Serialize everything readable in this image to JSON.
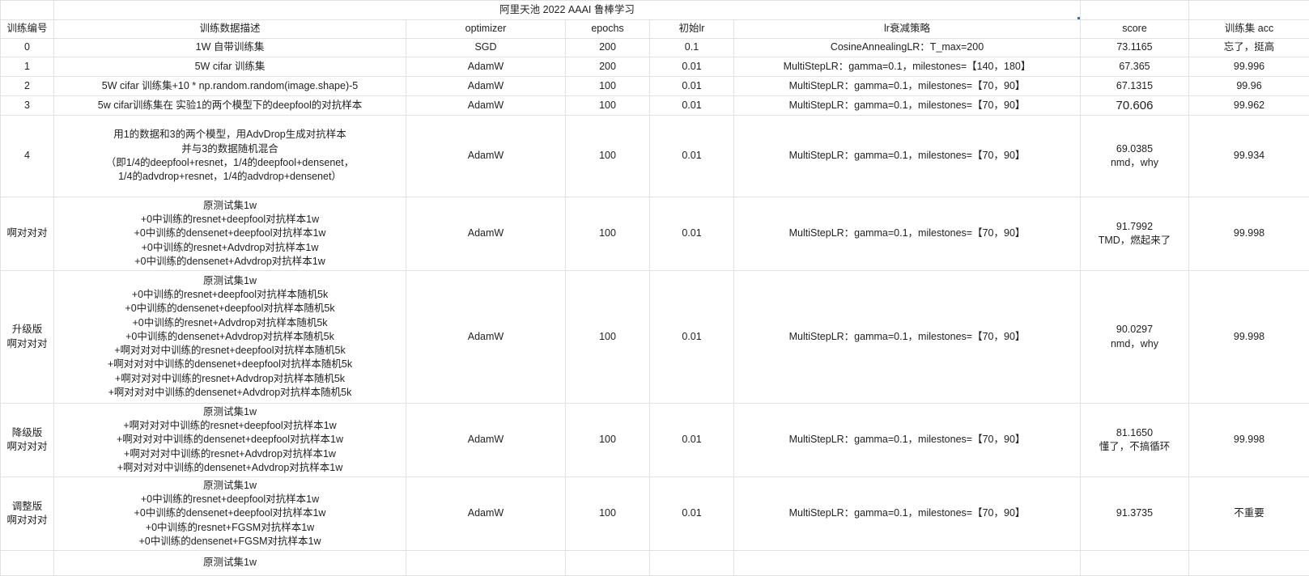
{
  "sheet": {
    "title": "阿里天池 2022 AAAI 鲁棒学习",
    "headers": [
      "训练编号",
      "训练数据描述",
      "optimizer",
      "epochs",
      "初始lr",
      "lr衰减策略",
      "score",
      "训练集 acc"
    ],
    "rows": [
      {
        "id": [
          "0"
        ],
        "desc": [
          "1W 自带训练集"
        ],
        "optimizer": "SGD",
        "epochs": "200",
        "lr": "0.1",
        "lr_strategy": "CosineAnnealingLR：T_max=200",
        "score": [
          "73.1165"
        ],
        "train_acc": "忘了，挺高"
      },
      {
        "id": [
          "1"
        ],
        "desc": [
          "5W cifar 训练集"
        ],
        "optimizer": "AdamW",
        "epochs": "200",
        "lr": "0.01",
        "lr_strategy": "MultiStepLR：gamma=0.1，milestones=【140，180】",
        "score": [
          "67.365"
        ],
        "train_acc": "99.996"
      },
      {
        "id": [
          "2"
        ],
        "desc": [
          "5W cifar 训练集+10 * np.random.random(image.shape)-5"
        ],
        "optimizer": "AdamW",
        "epochs": "100",
        "lr": "0.01",
        "lr_strategy": "MultiStepLR：gamma=0.1，milestones=【70，90】",
        "score": [
          "67.1315"
        ],
        "train_acc": "99.96"
      },
      {
        "id": [
          "3"
        ],
        "desc": [
          "5w cifar训练集在 实验1的两个模型下的deepfool的对抗样本"
        ],
        "optimizer": "AdamW",
        "epochs": "100",
        "lr": "0.01",
        "lr_strategy": "MultiStepLR：gamma=0.1，milestones=【70，90】",
        "score": [
          "70.606"
        ],
        "train_acc": "99.962"
      },
      {
        "id": [
          "4"
        ],
        "desc": [
          "用1的数据和3的两个模型，用AdvDrop生成对抗样本",
          "并与3的数据随机混合",
          "（即1/4的deepfool+resnet，1/4的deepfool+densenet，",
          "1/4的advdrop+resnet，1/4的advdrop+densenet）"
        ],
        "optimizer": "AdamW",
        "epochs": "100",
        "lr": "0.01",
        "lr_strategy": "MultiStepLR：gamma=0.1，milestones=【70，90】",
        "score": [
          "69.0385",
          "nmd，why"
        ],
        "train_acc": "99.934"
      },
      {
        "id": [
          "啊对对对"
        ],
        "desc": [
          "原测试集1w",
          "+0中训练的resnet+deepfool对抗样本1w",
          "+0中训练的densenet+deepfool对抗样本1w",
          "+0中训练的resnet+Advdrop对抗样本1w",
          "+0中训练的densenet+Advdrop对抗样本1w"
        ],
        "optimizer": "AdamW",
        "epochs": "100",
        "lr": "0.01",
        "lr_strategy": "MultiStepLR：gamma=0.1，milestones=【70，90】",
        "score": [
          "91.7992",
          "TMD，燃起来了"
        ],
        "train_acc": "99.998"
      },
      {
        "id": [
          "升级版",
          "啊对对对"
        ],
        "desc": [
          "原测试集1w",
          "+0中训练的resnet+deepfool对抗样本随机5k",
          "+0中训练的densenet+deepfool对抗样本随机5k",
          "+0中训练的resnet+Advdrop对抗样本随机5k",
          "+0中训练的densenet+Advdrop对抗样本随机5k",
          "+啊对对对中训练的resnet+deepfool对抗样本随机5k",
          "+啊对对对中训练的densenet+deepfool对抗样本随机5k",
          "+啊对对对中训练的resnet+Advdrop对抗样本随机5k",
          "+啊对对对中训练的densenet+Advdrop对抗样本随机5k"
        ],
        "optimizer": "AdamW",
        "epochs": "100",
        "lr": "0.01",
        "lr_strategy": "MultiStepLR：gamma=0.1，milestones=【70，90】",
        "score": [
          "90.0297",
          "nmd，why"
        ],
        "train_acc": "99.998"
      },
      {
        "id": [
          "降级版",
          "啊对对对"
        ],
        "desc": [
          "原测试集1w",
          "+啊对对对中训练的resnet+deepfool对抗样本1w",
          "+啊对对对中训练的densenet+deepfool对抗样本1w",
          "+啊对对对中训练的resnet+Advdrop对抗样本1w",
          "+啊对对对中训练的densenet+Advdrop对抗样本1w"
        ],
        "optimizer": "AdamW",
        "epochs": "100",
        "lr": "0.01",
        "lr_strategy": "MultiStepLR：gamma=0.1，milestones=【70，90】",
        "score": [
          "81.1650",
          "懂了，不搞循环"
        ],
        "train_acc": "99.998"
      },
      {
        "id": [
          "调整版",
          "啊对对对"
        ],
        "desc": [
          "原测试集1w",
          "+0中训练的resnet+deepfool对抗样本1w",
          "+0中训练的densenet+deepfool对抗样本1w",
          "+0中训练的resnet+FGSM对抗样本1w",
          "+0中训练的densenet+FGSM对抗样本1w"
        ],
        "optimizer": "AdamW",
        "epochs": "100",
        "lr": "0.01",
        "lr_strategy": "MultiStepLR：gamma=0.1，milestones=【70，90】",
        "score": [
          "91.3735"
        ],
        "train_acc": "不重要"
      },
      {
        "id": [
          ""
        ],
        "desc": [
          "原测试集1w"
        ],
        "optimizer": "",
        "epochs": "",
        "lr": "",
        "lr_strategy": "",
        "score": [
          ""
        ],
        "train_acc": ""
      }
    ]
  }
}
